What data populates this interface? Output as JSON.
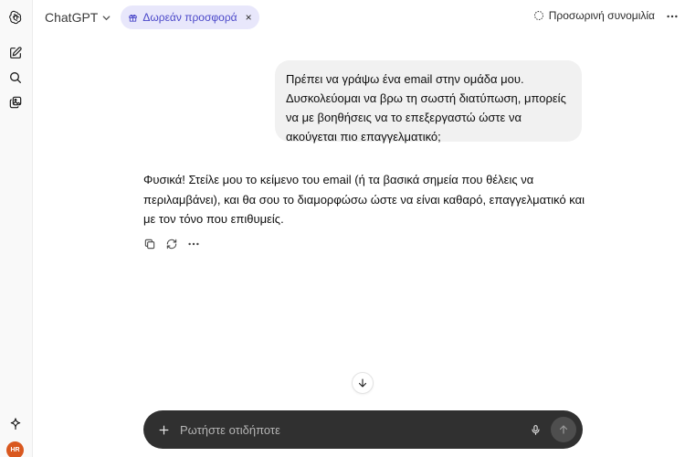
{
  "header": {
    "model_name": "ChatGPT",
    "offer_label": "Δωρεάν προσφορά",
    "offer_close": "×",
    "temporary_chat_label": "Προσωρινή συνομιλία"
  },
  "sidebar": {
    "avatar_initials": "HR",
    "avatar_color": "#d9581f",
    "icons": [
      "openai-logo-icon",
      "new-chat-icon",
      "search-icon",
      "library-icon",
      "sparkle-icon"
    ]
  },
  "conversation": {
    "user_message": "Πρέπει να γράψω ένα email στην ομάδα μου. Δυσκολεύομαι να βρω τη σωστή διατύπωση, μπορείς να με βοηθήσεις να το επεξεργαστώ ώστε να ακούγεται πιο επαγγελματικό;",
    "assistant_message": "Φυσικά! Στείλε μου το κείμενο του email (ή τα βασικά σημεία που θέλεις να περιλαμβάνει), και θα σου το διαμορφώσω ώστε να είναι καθαρό, επαγγελματικό και με τον τόνο που επιθυμείς."
  },
  "composer": {
    "placeholder": "Ρωτήστε οτιδήποτε",
    "value": ""
  },
  "colors": {
    "offer_bg": "#e8e7fb",
    "offer_text": "#4b48c9",
    "composer_bg": "#303030",
    "user_bubble_bg": "#f1f1f1"
  }
}
